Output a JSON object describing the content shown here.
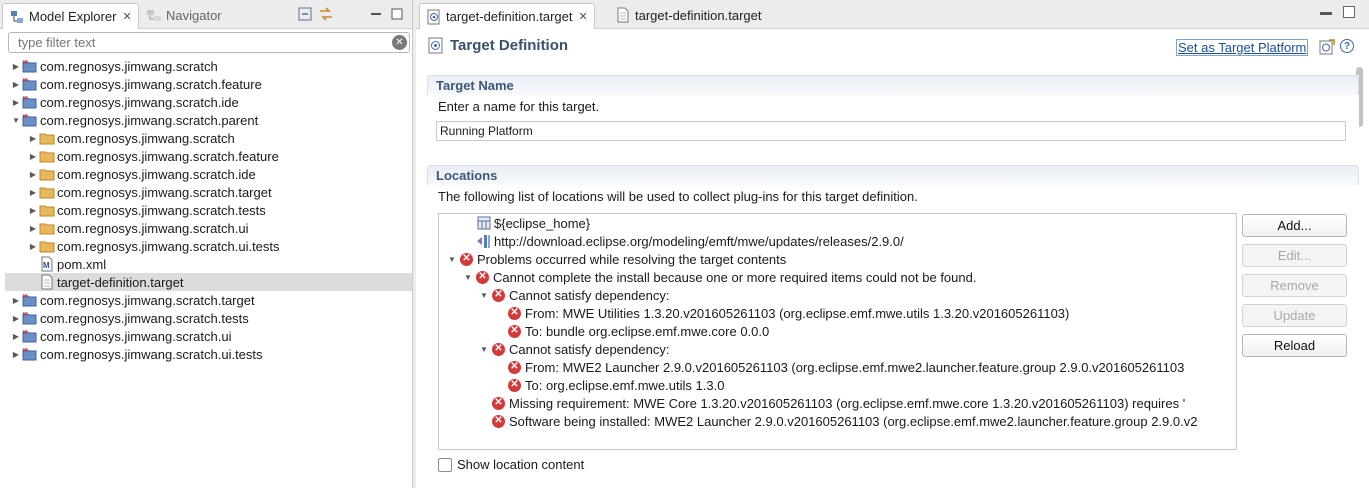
{
  "left_panel": {
    "tabs": [
      {
        "label": "Model Explorer",
        "icon": "model-explorer-icon",
        "closable": true
      },
      {
        "label": "Navigator",
        "icon": "navigator-icon"
      }
    ],
    "filter": {
      "placeholder": "type filter text",
      "value": ""
    },
    "tree": [
      {
        "label": "com.regnosys.jimwang.scratch",
        "indent": 0,
        "expanded": false,
        "icon": "project-icon"
      },
      {
        "label": "com.regnosys.jimwang.scratch.feature",
        "indent": 0,
        "expanded": false,
        "icon": "project-icon"
      },
      {
        "label": "com.regnosys.jimwang.scratch.ide",
        "indent": 0,
        "expanded": false,
        "icon": "project-icon"
      },
      {
        "label": "com.regnosys.jimwang.scratch.parent",
        "indent": 0,
        "expanded": true,
        "icon": "project-icon"
      },
      {
        "label": "com.regnosys.jimwang.scratch",
        "indent": 1,
        "expanded": false,
        "icon": "folder-icon"
      },
      {
        "label": "com.regnosys.jimwang.scratch.feature",
        "indent": 1,
        "expanded": false,
        "icon": "folder-icon"
      },
      {
        "label": "com.regnosys.jimwang.scratch.ide",
        "indent": 1,
        "expanded": false,
        "icon": "folder-icon"
      },
      {
        "label": "com.regnosys.jimwang.scratch.target",
        "indent": 1,
        "expanded": false,
        "icon": "folder-icon"
      },
      {
        "label": "com.regnosys.jimwang.scratch.tests",
        "indent": 1,
        "expanded": false,
        "icon": "folder-icon"
      },
      {
        "label": "com.regnosys.jimwang.scratch.ui",
        "indent": 1,
        "expanded": false,
        "icon": "folder-icon"
      },
      {
        "label": "com.regnosys.jimwang.scratch.ui.tests",
        "indent": 1,
        "expanded": false,
        "icon": "folder-icon"
      },
      {
        "label": "pom.xml",
        "indent": 1,
        "leaf": true,
        "icon": "maven-file-icon"
      },
      {
        "label": "target-definition.target",
        "indent": 1,
        "leaf": true,
        "icon": "file-icon",
        "selected": true
      },
      {
        "label": "com.regnosys.jimwang.scratch.target",
        "indent": 0,
        "expanded": false,
        "icon": "project-icon"
      },
      {
        "label": "com.regnosys.jimwang.scratch.tests",
        "indent": 0,
        "expanded": false,
        "icon": "project-icon"
      },
      {
        "label": "com.regnosys.jimwang.scratch.ui",
        "indent": 0,
        "expanded": false,
        "icon": "project-icon"
      },
      {
        "label": "com.regnosys.jimwang.scratch.ui.tests",
        "indent": 0,
        "expanded": false,
        "icon": "project-icon"
      }
    ]
  },
  "editor": {
    "tabs": [
      {
        "label": "target-definition.target",
        "active": true,
        "closable": true,
        "icon": "target-icon"
      },
      {
        "label": "target-definition.target",
        "active": false,
        "icon": "file-icon"
      }
    ],
    "title": "Target Definition",
    "set_platform_link": "Set as Target Platform",
    "help_glyph": "?",
    "target_name": {
      "heading": "Target Name",
      "description": "Enter a name for this target.",
      "value": "Running Platform"
    },
    "locations": {
      "heading": "Locations",
      "description": "The following list of locations will be used to collect plug-ins for this target definition.",
      "rows": [
        {
          "text": "${eclipse_home}",
          "icon": "installation-icon",
          "indent": 1
        },
        {
          "text": "http://download.eclipse.org/modeling/emft/mwe/updates/releases/2.9.0/",
          "icon": "update-site-icon",
          "indent": 1
        },
        {
          "text": "Problems occurred while resolving the target contents",
          "icon": "error-icon",
          "indent": 0,
          "twisty": "open"
        },
        {
          "text": "Cannot complete the install because one or more required items could not be found.",
          "icon": "error-icon",
          "indent": 1,
          "twisty": "open"
        },
        {
          "text": "Cannot satisfy dependency:",
          "icon": "error-icon",
          "indent": 2,
          "twisty": "open"
        },
        {
          "text": "From: MWE Utilities 1.3.20.v201605261103 (org.eclipse.emf.mwe.utils 1.3.20.v201605261103)",
          "icon": "error-icon",
          "indent": 3
        },
        {
          "text": "To: bundle org.eclipse.emf.mwe.core 0.0.0",
          "icon": "error-icon",
          "indent": 3
        },
        {
          "text": "Cannot satisfy dependency:",
          "icon": "error-icon",
          "indent": 2,
          "twisty": "open"
        },
        {
          "text": "From: MWE2 Launcher 2.9.0.v201605261103 (org.eclipse.emf.mwe2.launcher.feature.group 2.9.0.v201605261103",
          "icon": "error-icon",
          "indent": 3
        },
        {
          "text": "To: org.eclipse.emf.mwe.utils 1.3.0",
          "icon": "error-icon",
          "indent": 3
        },
        {
          "text": "Missing requirement: MWE Core 1.3.20.v201605261103 (org.eclipse.emf.mwe.core 1.3.20.v201605261103) requires '",
          "icon": "error-icon",
          "indent": 2
        },
        {
          "text": "Software being installed: MWE2 Launcher 2.9.0.v201605261103 (org.eclipse.emf.mwe2.launcher.feature.group 2.9.0.v2",
          "icon": "error-icon",
          "indent": 2
        }
      ],
      "buttons": [
        {
          "label": "Add...",
          "enabled": true
        },
        {
          "label": "Edit...",
          "enabled": false
        },
        {
          "label": "Remove",
          "enabled": false
        },
        {
          "label": "Update",
          "enabled": false
        },
        {
          "label": "Reload",
          "enabled": true
        }
      ],
      "show_content": {
        "label": "Show location content",
        "checked": false
      }
    }
  }
}
